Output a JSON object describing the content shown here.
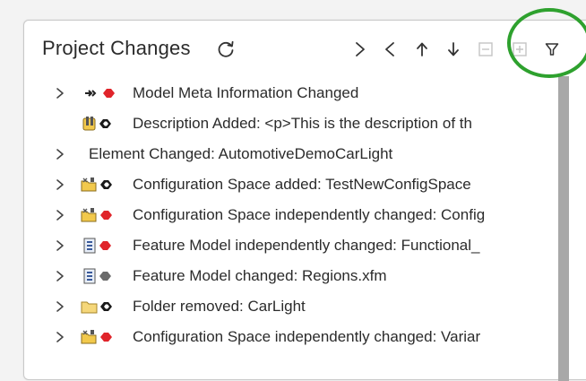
{
  "panel": {
    "title": "Project Changes"
  },
  "toolbar": {
    "refresh_icon": "refresh-icon",
    "next_icon": "chevron-right-icon",
    "prev_icon": "chevron-left-icon",
    "up_icon": "arrow-up-icon",
    "down_icon": "arrow-down-icon",
    "collapse_icon": "collapse-all-icon",
    "expand_icon": "expand-all-icon",
    "filter_icon": "filter-icon"
  },
  "colors": {
    "highlight_circle": "#2ea12e",
    "changed_marker": "#e0242a",
    "added_marker": "#1a1a1a",
    "folder": "#f2c94c"
  },
  "changes": [
    {
      "label": "Model Meta Information Changed",
      "expandable": true,
      "icon": "meta-changed-icon"
    },
    {
      "label": "Description Added: <p>This is the description of th",
      "expandable": false,
      "icon": "description-added-icon"
    },
    {
      "label": "Element Changed: AutomotiveDemoCarLight",
      "expandable": true,
      "icon": ""
    },
    {
      "label": "Configuration Space added: TestNewConfigSpace",
      "expandable": true,
      "icon": "config-space-added-icon"
    },
    {
      "label": "Configuration Space independently changed: Config",
      "expandable": true,
      "icon": "config-space-changed-icon"
    },
    {
      "label": "Feature Model independently changed: Functional_",
      "expandable": true,
      "icon": "feature-model-changed-icon"
    },
    {
      "label": "Feature Model changed: Regions.xfm",
      "expandable": true,
      "icon": "feature-model-gray-icon"
    },
    {
      "label": "Folder removed: CarLight",
      "expandable": true,
      "icon": "folder-removed-icon"
    },
    {
      "label": "Configuration Space independently changed: Variar",
      "expandable": true,
      "icon": "config-space-changed-icon"
    }
  ]
}
